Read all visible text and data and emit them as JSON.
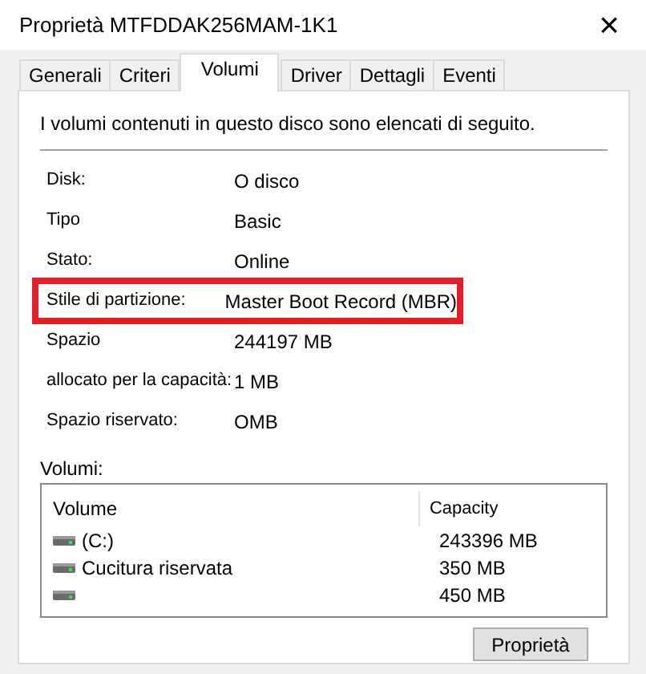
{
  "window": {
    "title": "Proprietà MTFDDAK256MAM-1K1",
    "close": "×"
  },
  "tabs": [
    {
      "label": "Generali",
      "selected": false
    },
    {
      "label": "Criteri",
      "selected": false
    },
    {
      "label": "Volumi",
      "selected": true
    },
    {
      "label": "Driver",
      "selected": false
    },
    {
      "label": "Dettagli",
      "selected": false
    },
    {
      "label": "Eventi",
      "selected": false
    }
  ],
  "intro": "I volumi contenuti in questo disco sono elencati di seguito.",
  "properties": [
    {
      "label": "Disk:",
      "value": "O disco",
      "highlighted": false
    },
    {
      "label": "Tipo",
      "value": "Basic",
      "highlighted": false
    },
    {
      "label": "Stato:",
      "value": "Online",
      "highlighted": false
    },
    {
      "label": "Stile di partizione:",
      "value": "Master Boot Record (MBR)",
      "highlighted": true
    },
    {
      "label": "Spazio",
      "value": "244197 MB",
      "highlighted": false
    },
    {
      "label": "allocato per la capacità:",
      "value": "1 MB",
      "highlighted": false
    },
    {
      "label": "Spazio riservato:",
      "value": "OMB",
      "highlighted": false
    }
  ],
  "volumes": {
    "label": "Volumi:",
    "columns": [
      "Volume",
      "Capacity"
    ],
    "rows": [
      {
        "volume": "(C:)",
        "capacity": "243396 MB"
      },
      {
        "volume": "Cucitura riservata",
        "capacity": "350 MB"
      },
      {
        "capacity": "450 MB"
      }
    ]
  },
  "buttons": [
    "Proprietà"
  ]
}
